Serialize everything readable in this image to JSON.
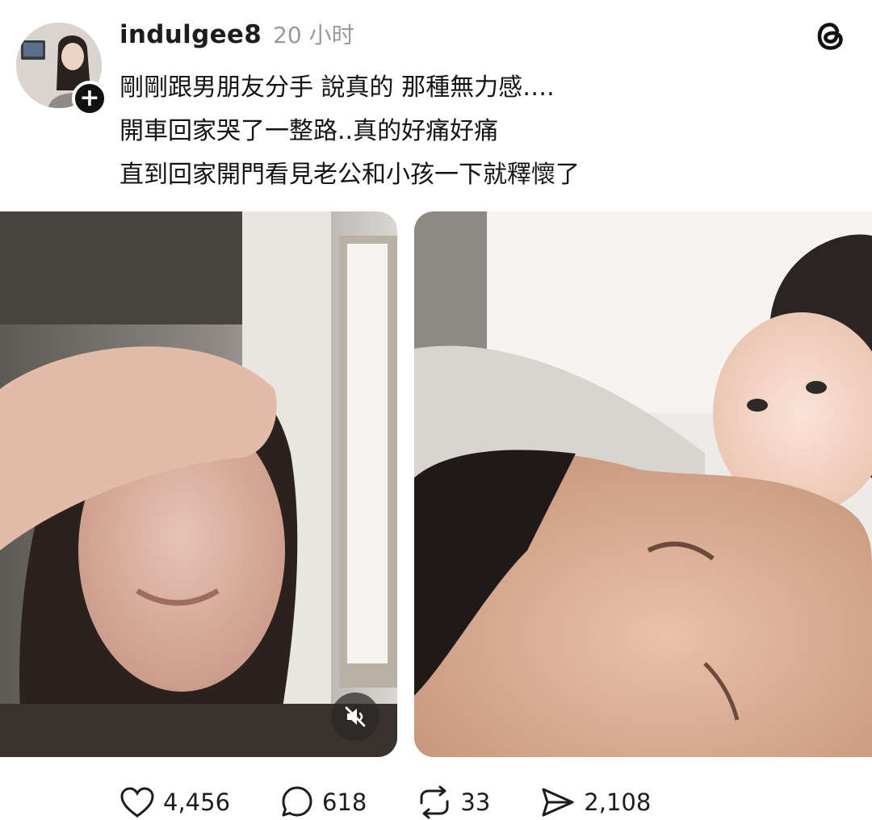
{
  "post": {
    "username": "indulgee8",
    "timestamp": "20 小时",
    "follow_symbol": "+",
    "lines": [
      "剛剛跟男朋友分手 說真的 那種無力感….",
      "開車回家哭了一整路..真的好痛好痛",
      "直到回家開門看見老公和小孩一下就釋懷了"
    ]
  },
  "media": {
    "item_count": 2,
    "items": [
      {
        "kind": "video",
        "muted": true,
        "icon": "speaker-muted-icon"
      },
      {
        "kind": "photo"
      }
    ]
  },
  "actions": {
    "like": {
      "icon": "heart-icon",
      "count": "4,456"
    },
    "reply": {
      "icon": "comment-icon",
      "count": "618"
    },
    "repost": {
      "icon": "repost-icon",
      "count": "33"
    },
    "share": {
      "icon": "send-icon",
      "count": "2,108"
    }
  },
  "app": {
    "logo": "threads-logo-icon"
  }
}
